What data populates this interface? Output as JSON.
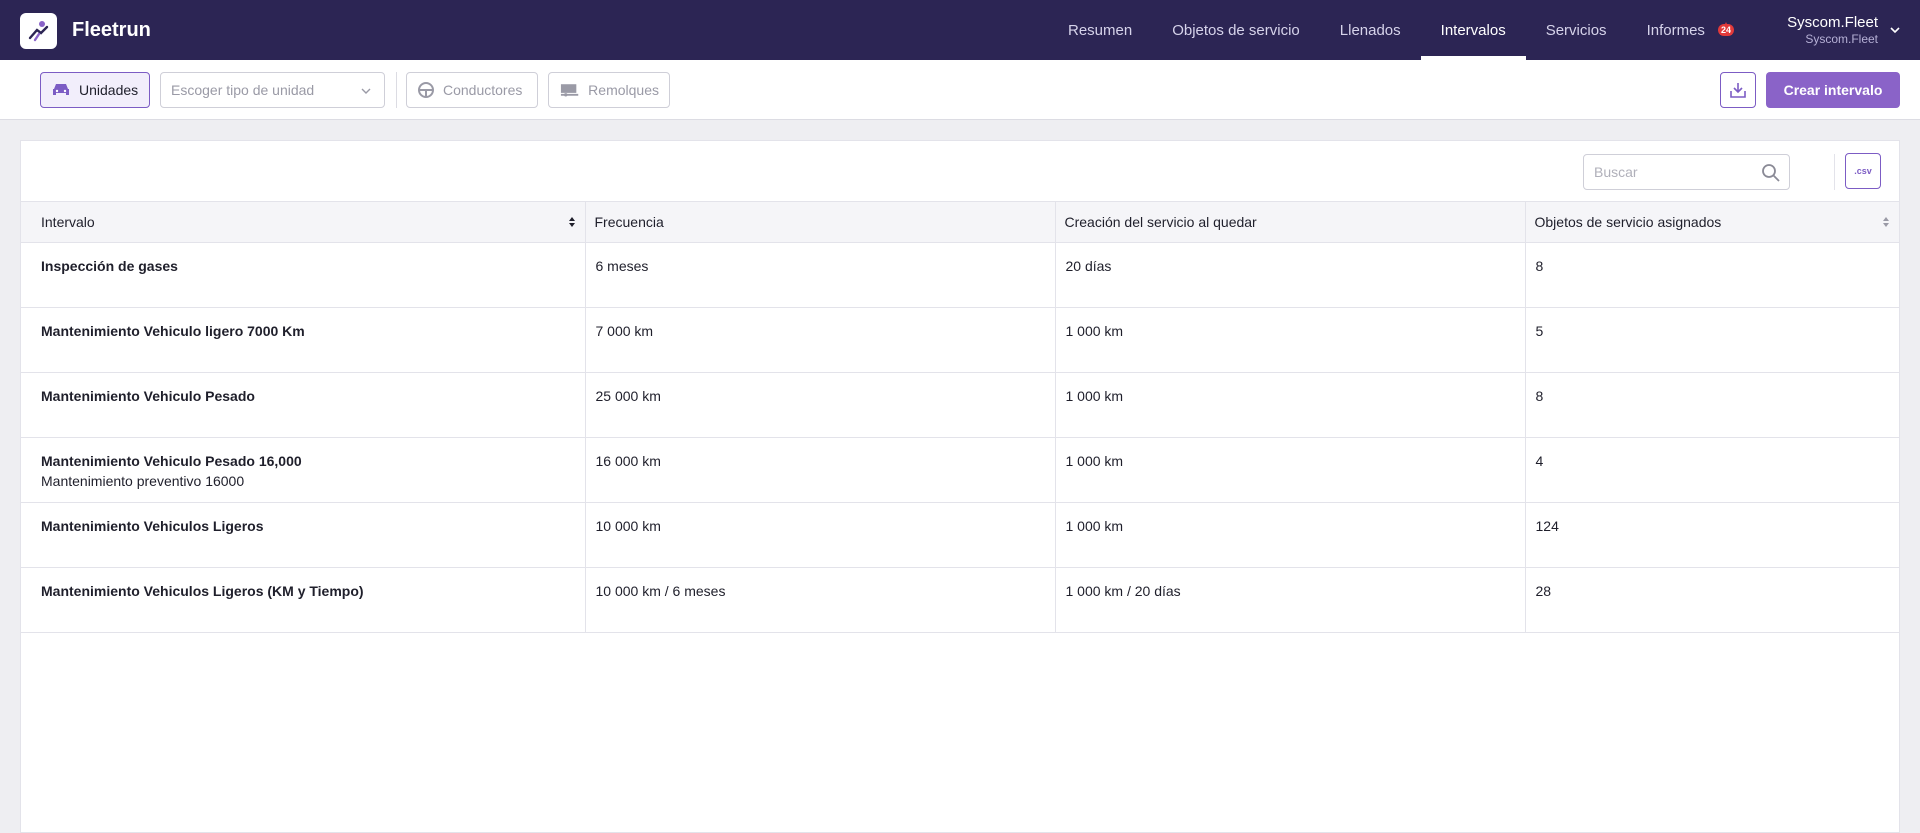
{
  "app": {
    "name": "Fleetrun"
  },
  "nav": {
    "items": [
      {
        "label": "Resumen",
        "active": false
      },
      {
        "label": "Objetos de servicio",
        "active": false
      },
      {
        "label": "Llenados",
        "active": false
      },
      {
        "label": "Intervalos",
        "active": true
      },
      {
        "label": "Servicios",
        "active": false
      },
      {
        "label": "Informes",
        "active": false
      }
    ],
    "notification_badge": "24"
  },
  "user": {
    "name": "Syscom.Fleet",
    "account": "Syscom.Fleet"
  },
  "toolbar": {
    "units_label": "Unidades",
    "unit_type_placeholder": "Escoger tipo de unidad",
    "drivers_label": "Conductores",
    "trailers_label": "Remolques",
    "create_label": "Crear intervalo"
  },
  "search": {
    "placeholder": "Buscar"
  },
  "csv_label": ".csv",
  "table": {
    "headers": [
      "Intervalo",
      "Frecuencia",
      "Creación del servicio al quedar",
      "Objetos de servicio asignados"
    ],
    "rows": [
      {
        "name": "Inspección de gases",
        "desc": "",
        "frequency": "6 meses",
        "creation": "20 días",
        "assigned": "8"
      },
      {
        "name": "Mantenimiento Vehiculo ligero 7000 Km",
        "desc": "",
        "frequency": "7 000 km",
        "creation": "1 000 km",
        "assigned": "5"
      },
      {
        "name": "Mantenimiento Vehiculo Pesado",
        "desc": "",
        "frequency": "25 000 km",
        "creation": "1 000 km",
        "assigned": "8"
      },
      {
        "name": "Mantenimiento Vehiculo Pesado 16,000",
        "desc": "Mantenimiento preventivo 16000",
        "frequency": "16 000 km",
        "creation": "1 000 km",
        "assigned": "4"
      },
      {
        "name": "Mantenimiento Vehiculos Ligeros",
        "desc": "",
        "frequency": "10 000 km",
        "creation": "1 000 km",
        "assigned": "124"
      },
      {
        "name": "Mantenimiento Vehiculos Ligeros (KM y Tiempo)",
        "desc": "",
        "frequency": "10 000 km / 6 meses",
        "creation": "1 000 km / 20 días",
        "assigned": "28"
      }
    ]
  },
  "colors": {
    "topbar": "#2c2554",
    "accent": "#8a63c8",
    "badge": "#e23a3a"
  }
}
